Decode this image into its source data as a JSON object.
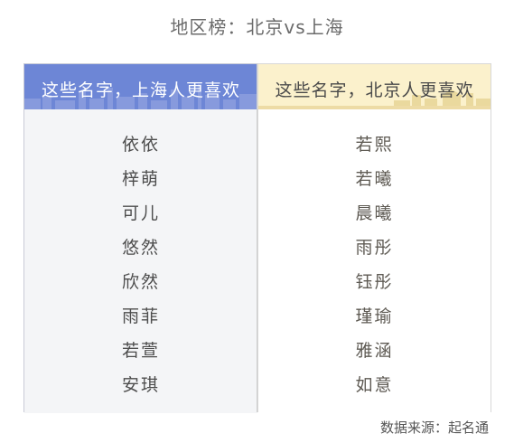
{
  "title": "地区榜：北京vs上海",
  "left_column": {
    "header": "这些名字，上海人更喜欢",
    "names": [
      "依依",
      "梓萌",
      "可儿",
      "悠然",
      "欣然",
      "雨菲",
      "若萱",
      "安琪"
    ]
  },
  "right_column": {
    "header": "这些名字，北京人更喜欢",
    "names": [
      "若熙",
      "若曦",
      "晨曦",
      "雨彤",
      "钰彤",
      "瑾瑜",
      "雅涵",
      "如意"
    ]
  },
  "source": "数据来源：起名通",
  "colors": {
    "left_header": "#6d86d6",
    "right_header": "#fbf1cc"
  }
}
